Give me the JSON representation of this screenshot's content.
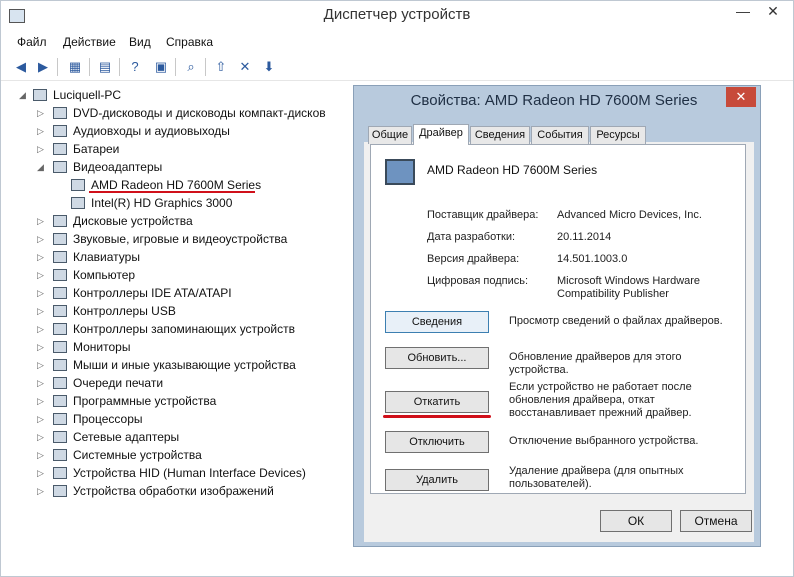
{
  "window": {
    "title": "Диспетчер устройств"
  },
  "menu": [
    "Файл",
    "Действие",
    "Вид",
    "Справка"
  ],
  "tree": {
    "root": "Luciquell-PC",
    "items": [
      {
        "label": "DVD-дисководы и дисководы компакт-дисков",
        "expander": "▷"
      },
      {
        "label": "Аудиовходы и аудиовыходы",
        "expander": "▷"
      },
      {
        "label": "Батареи",
        "expander": "▷"
      },
      {
        "label": "Видеоадаптеры",
        "expander": "◢"
      },
      {
        "label": "AMD Radeon HD 7600M Series",
        "expander": ""
      },
      {
        "label": "Intel(R) HD Graphics 3000",
        "expander": ""
      },
      {
        "label": "Дисковые устройства",
        "expander": "▷"
      },
      {
        "label": "Звуковые, игровые и видеоустройства",
        "expander": "▷"
      },
      {
        "label": "Клавиатуры",
        "expander": "▷"
      },
      {
        "label": "Компьютер",
        "expander": "▷"
      },
      {
        "label": "Контроллеры IDE ATA/ATAPI",
        "expander": "▷"
      },
      {
        "label": "Контроллеры USB",
        "expander": "▷"
      },
      {
        "label": "Контроллеры запоминающих устройств",
        "expander": "▷"
      },
      {
        "label": "Мониторы",
        "expander": "▷"
      },
      {
        "label": "Мыши и иные указывающие устройства",
        "expander": "▷"
      },
      {
        "label": "Очереди печати",
        "expander": "▷"
      },
      {
        "label": "Программные устройства",
        "expander": "▷"
      },
      {
        "label": "Процессоры",
        "expander": "▷"
      },
      {
        "label": "Сетевые адаптеры",
        "expander": "▷"
      },
      {
        "label": "Системные устройства",
        "expander": "▷"
      },
      {
        "label": "Устройства HID (Human Interface Devices)",
        "expander": "▷"
      },
      {
        "label": "Устройства обработки изображений",
        "expander": "▷"
      }
    ]
  },
  "dialog": {
    "title": "Свойства: AMD Radeon HD 7600M Series",
    "tabs": [
      "Общие",
      "Драйвер",
      "Сведения",
      "События",
      "Ресурсы"
    ],
    "device_name": "AMD Radeon HD 7600M Series",
    "info": [
      {
        "label": "Поставщик драйвера:",
        "value": "Advanced Micro Devices, Inc."
      },
      {
        "label": "Дата разработки:",
        "value": "20.11.2014"
      },
      {
        "label": "Версия драйвера:",
        "value": "14.501.1003.0"
      },
      {
        "label": "Цифровая подпись:",
        "value": "Microsoft Windows Hardware Compatibility Publisher"
      }
    ],
    "buttons": [
      {
        "label": "Сведения",
        "desc": "Просмотр сведений о файлах драйверов."
      },
      {
        "label": "Обновить...",
        "desc": "Обновление драйверов для этого устройства."
      },
      {
        "label": "Откатить",
        "desc": "Если устройство не работает после обновления драйвера, откат восстанавливает прежний драйвер."
      },
      {
        "label": "Отключить",
        "desc": "Отключение выбранного устройства."
      },
      {
        "label": "Удалить",
        "desc": "Удаление драйвера (для опытных пользователей)."
      }
    ],
    "ok": "ОК",
    "cancel": "Отмена"
  },
  "accent": "#d0101a"
}
